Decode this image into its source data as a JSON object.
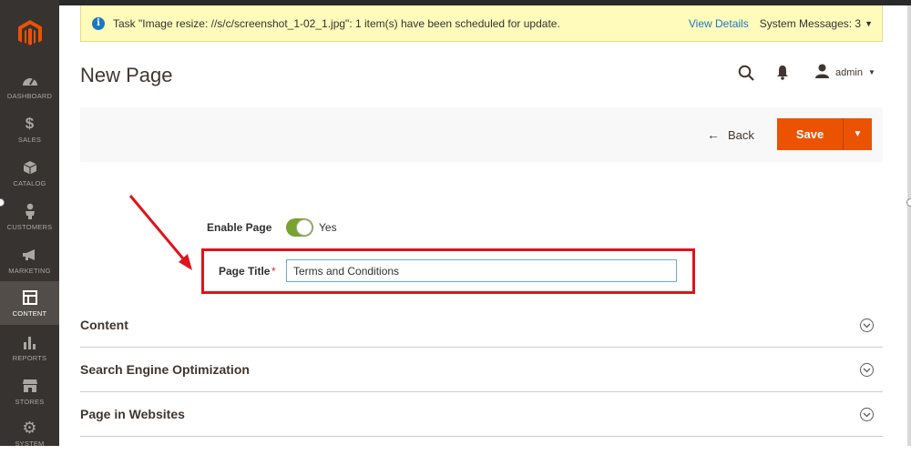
{
  "sidebar": {
    "logo_icon": "magento-logo-icon",
    "brand_color": "#eb5202",
    "items": [
      {
        "label": "DASHBOARD",
        "icon": "speedometer-icon"
      },
      {
        "label": "SALES",
        "icon": "dollar-icon"
      },
      {
        "label": "CATALOG",
        "icon": "box-icon"
      },
      {
        "label": "CUSTOMERS",
        "icon": "person-icon"
      },
      {
        "label": "MARKETING",
        "icon": "megaphone-icon"
      },
      {
        "label": "CONTENT",
        "icon": "layout-icon",
        "active": true
      },
      {
        "label": "REPORTS",
        "icon": "bar-chart-icon"
      },
      {
        "label": "STORES",
        "icon": "storefront-icon"
      },
      {
        "label": "SYSTEM",
        "icon": "gear-icon"
      }
    ]
  },
  "message_bar": {
    "text": "Task \"Image resize: //s/c/screenshot_1-02_1.jpg\": 1 item(s) have been scheduled for update.",
    "view_details": "View Details",
    "system_messages": "System Messages: 3"
  },
  "header": {
    "title": "New Page",
    "user": "admin"
  },
  "actions": {
    "back_label": "Back",
    "save_label": "Save"
  },
  "form": {
    "enable_label": "Enable Page",
    "enable_value": "Yes",
    "enabled": true,
    "title_label": "Page Title",
    "required_mark": "*",
    "title_value": "Terms and Conditions"
  },
  "sections": [
    {
      "title": "Content"
    },
    {
      "title": "Search Engine Optimization"
    },
    {
      "title": "Page in Websites"
    }
  ],
  "colors": {
    "accent": "#eb5202",
    "toggle_on": "#79a22e",
    "highlight": "#e0131a",
    "link": "#1979c3"
  }
}
